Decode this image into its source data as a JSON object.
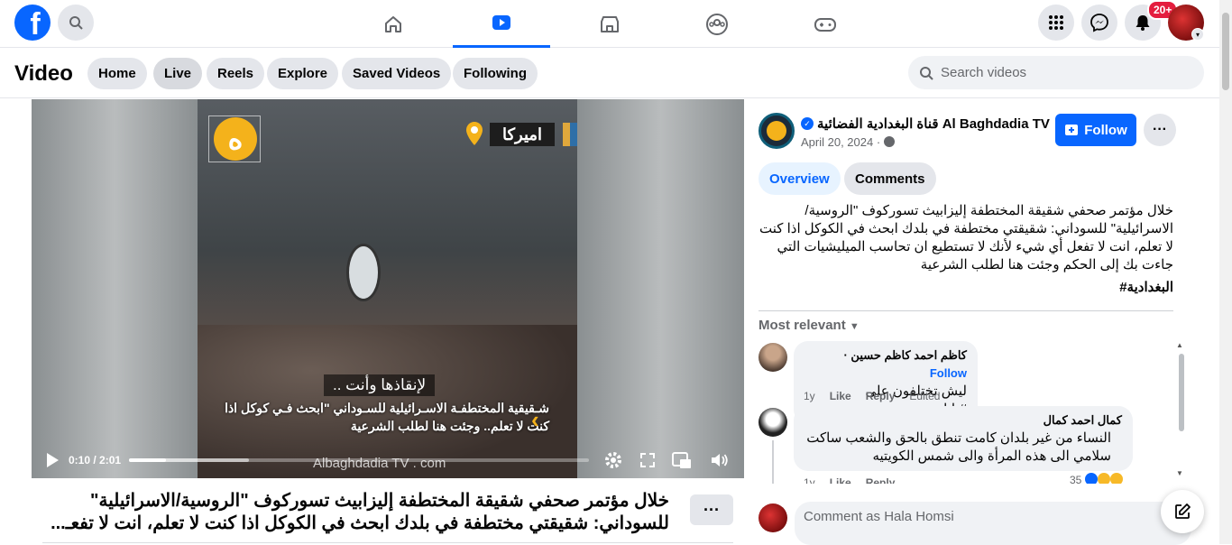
{
  "nav": {
    "logo": "f",
    "notifications_badge": "20+",
    "tabs": [
      "home-icon",
      "video-icon",
      "marketplace-icon",
      "groups-icon",
      "gaming-icon"
    ],
    "active_tab": "video-icon",
    "accent": "#0866ff"
  },
  "subbar": {
    "title": "Video",
    "pills": [
      "Home",
      "Live",
      "Reels",
      "Explore",
      "Saved Videos",
      "Following"
    ],
    "active_pill": "Live",
    "search_placeholder": "Search videos"
  },
  "video": {
    "location_tag": "اميركا",
    "logo_letter": "ه",
    "subtitle_line1": ".. لإنقاذها وأنت",
    "subtitle_line2": "شـقيقية المختطفـة الاسـرائيلية للسـوداني \"ابحث فـي كوكل اذا كنت لا تعلم.. وجئت هنا لطلب الشرعية",
    "watermark": "Albaghdadia TV . com",
    "time": "0:10 / 2:01",
    "progress": 0.08,
    "buffered": 0.26
  },
  "caption": {
    "line1": "خلال مؤتمر صحفي شقيقة المختطفة إليزابيث تسوركوف \"الروسية/الاسرائيلية\"",
    "line2": "للسوداني: شقيقتي مختطفة في بلدك ابحث في الكوكل اذا كنت لا تعلم، انت لا تفعـ..."
  },
  "post": {
    "page_name": "قناة البغدادية الفضائية Al Baghdadia TV",
    "date": "April 20, 2024 · ",
    "follow_label": "Follow",
    "tabs": [
      "Overview",
      "Comments"
    ],
    "description": "خلال مؤتمر صحفي شقيقة المختطفة إليزابيث تسوركوف \"الروسية/الاسرائيلية\" للسوداني: شقيقتي مختطفة في بلدك ابحث في الكوكل اذا كنت لا تعلم، انت لا تفعل أي شيء لأنك لا تستطيع ان تحاسب الميليشيات التي جاءت بك إلى الحكم وجئت هنا لطلب الشرعية",
    "hashtag": "#البغدادية",
    "sort_label": "Most relevant"
  },
  "comments": [
    {
      "name": "كاظم احمد كاظم حسين",
      "follow": "Follow",
      "text": "ليش تختلفون على #بابا_محمد",
      "time": "1y",
      "like": "Like",
      "reply": "Reply",
      "edited": "Edited"
    },
    {
      "name": "كمال احمد كمال",
      "text": "النساء من غير بلدان كامت تنطق بالحق والشعب ساكت سلامي الى هذه المرأة والى شمس الكويتيه",
      "time": "1y",
      "like": "Like",
      "reply": "Reply",
      "reactions": "35"
    }
  ],
  "comment_input_placeholder": "Comment as Hala Homsi"
}
